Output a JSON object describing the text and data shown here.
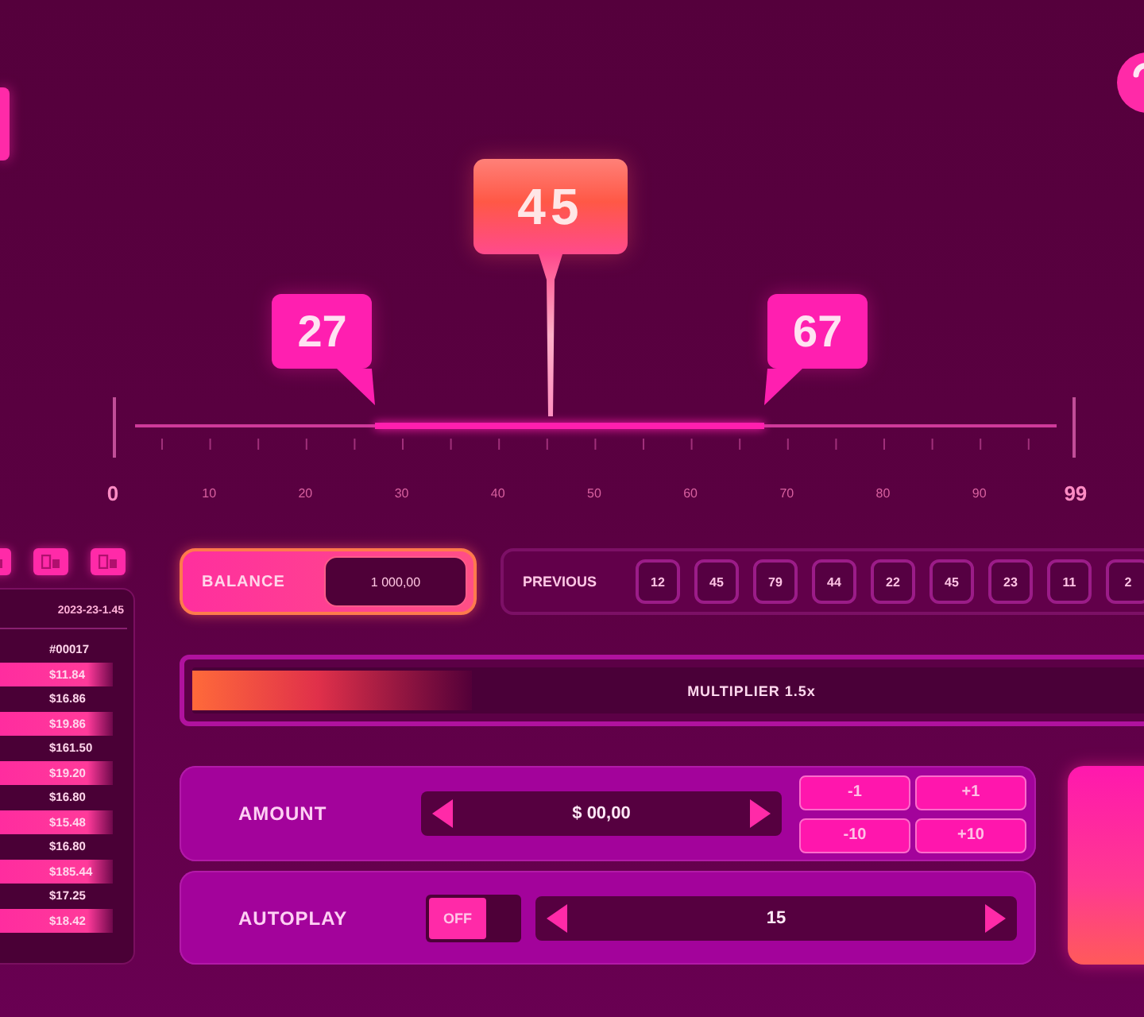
{
  "scale": {
    "ticks": [
      "0",
      "10",
      "20",
      "30",
      "40",
      "50",
      "60",
      "70",
      "80",
      "90",
      "99"
    ],
    "markers": [
      {
        "kind": "low",
        "label": "27"
      },
      {
        "kind": "high",
        "label": "67"
      },
      {
        "kind": "result",
        "label": "45"
      }
    ]
  },
  "history": {
    "date": "2023-23-1.45",
    "rows": [
      {
        "amount": "#00017",
        "highlighted": false
      },
      {
        "amount": "$11.84",
        "highlighted": true
      },
      {
        "amount": "$16.86",
        "highlighted": false
      },
      {
        "amount": "$19.86",
        "highlighted": true
      },
      {
        "amount": "$161.50",
        "highlighted": false
      },
      {
        "amount": "$19.20",
        "highlighted": true
      },
      {
        "amount": "$16.80",
        "highlighted": false
      },
      {
        "amount": "$15.48",
        "highlighted": true
      },
      {
        "amount": "$16.80",
        "highlighted": false
      },
      {
        "amount": "$185.44",
        "highlighted": true
      },
      {
        "amount": "$17.25",
        "highlighted": false
      },
      {
        "amount": "$18.42",
        "highlighted": true
      }
    ]
  },
  "balance": {
    "label": "BALANCE",
    "value": "1 000,00"
  },
  "previous": {
    "label": "PREVIOUS",
    "results": [
      "12",
      "45",
      "79",
      "44",
      "22",
      "45",
      "23",
      "11",
      "2"
    ]
  },
  "multiplier": {
    "label": "MULTIPLIER 1.5x",
    "level": 0.25
  },
  "amount": {
    "label": "AMOUNT",
    "value": "$ 00,00",
    "steps": [
      "-1",
      "+1",
      "-10",
      "+10"
    ]
  },
  "autoplay": {
    "label": "AUTOPLAY",
    "toggle": {
      "label": "OFF",
      "on": false
    },
    "rounds": "15"
  }
}
